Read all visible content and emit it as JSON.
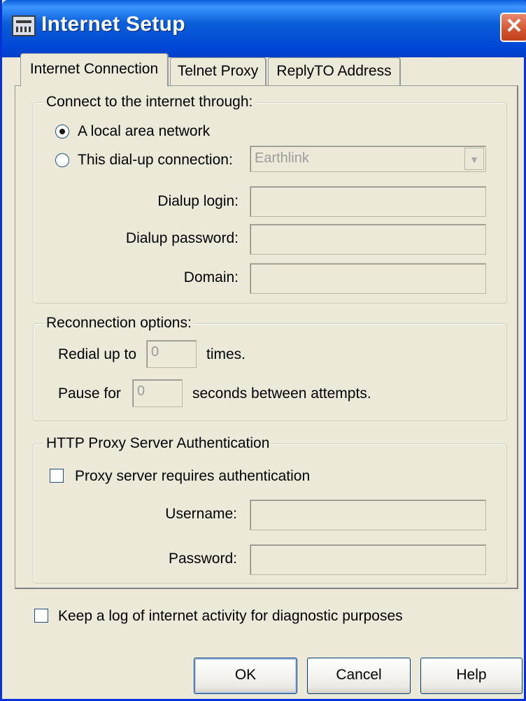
{
  "window": {
    "title": "Internet Setup",
    "close_glyph": "✕"
  },
  "tabs": [
    {
      "label": "Internet Connection",
      "active": true
    },
    {
      "label": "Telnet Proxy",
      "active": false
    },
    {
      "label": "ReplyTO Address",
      "active": false
    }
  ],
  "connect_group": {
    "legend": "Connect to the internet through:",
    "options": [
      {
        "label": "A local area network",
        "selected": true
      },
      {
        "label": "This dial-up connection:",
        "selected": false
      }
    ],
    "dialup_connection": {
      "value": "Earthlink",
      "arrow_glyph": "▼"
    },
    "dialup_login": {
      "label": "Dialup login:",
      "value": ""
    },
    "dialup_password": {
      "label": "Dialup password:",
      "value": ""
    },
    "domain": {
      "label": "Domain:",
      "value": ""
    }
  },
  "reconnect_group": {
    "legend": "Reconnection options:",
    "redial_label": "Redial up to",
    "redial_value": "0",
    "redial_suffix": "times.",
    "pause_label": "Pause for",
    "pause_value": "0",
    "pause_suffix": "seconds between attempts."
  },
  "proxy_group": {
    "legend": "HTTP Proxy Server Authentication",
    "requires_auth_label": "Proxy server requires authentication",
    "requires_auth_checked": false,
    "username": {
      "label": "Username:",
      "value": ""
    },
    "password": {
      "label": "Password:",
      "value": ""
    }
  },
  "log_option": {
    "label": "Keep a log of internet activity for diagnostic purposes",
    "checked": false
  },
  "buttons": {
    "ok": "OK",
    "cancel": "Cancel",
    "help": "Help"
  },
  "colors": {
    "titlebar": "#0a5fd8",
    "dialog_bg": "#ece9d8",
    "close_button": "#d2542f"
  }
}
